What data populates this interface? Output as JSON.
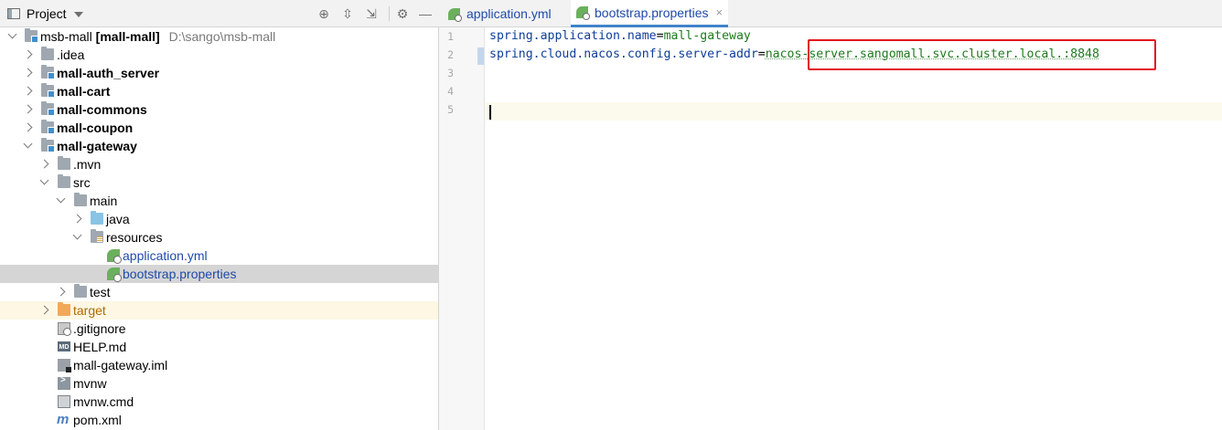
{
  "project_panel": {
    "title": "Project",
    "tree": [
      {
        "label": "msb-mall",
        "bold_suffix": "[mall-mall]",
        "hint": "D:\\sango\\msb-mall",
        "icon": "module-folder-icon"
      },
      {
        "label": ".idea",
        "icon": "folder-icon"
      },
      {
        "label": "mall-auth_server",
        "icon": "module-folder-icon"
      },
      {
        "label": "mall-cart",
        "icon": "module-folder-icon"
      },
      {
        "label": "mall-commons",
        "icon": "module-folder-icon"
      },
      {
        "label": "mall-coupon",
        "icon": "module-folder-icon"
      },
      {
        "label": "mall-gateway",
        "icon": "module-folder-icon"
      },
      {
        "label": ".mvn",
        "icon": "folder-icon"
      },
      {
        "label": "src",
        "icon": "folder-icon"
      },
      {
        "label": "main",
        "icon": "folder-icon"
      },
      {
        "label": "java",
        "icon": "source-folder-icon"
      },
      {
        "label": "resources",
        "icon": "resources-folder-icon"
      },
      {
        "label": "application.yml",
        "icon": "spring-config-icon"
      },
      {
        "label": "bootstrap.properties",
        "icon": "spring-config-icon"
      },
      {
        "label": "test",
        "icon": "folder-icon"
      },
      {
        "label": "target",
        "icon": "excluded-folder-icon"
      },
      {
        "label": ".gitignore",
        "icon": "gitignore-icon"
      },
      {
        "label": "HELP.md",
        "icon": "markdown-icon"
      },
      {
        "label": "mall-gateway.iml",
        "icon": "iml-icon"
      },
      {
        "label": "mvnw",
        "icon": "terminal-script-icon"
      },
      {
        "label": "mvnw.cmd",
        "icon": "cmd-file-icon"
      },
      {
        "label": "pom.xml",
        "icon": "maven-icon"
      }
    ],
    "md_badge": "MD"
  },
  "editor": {
    "tabs": [
      {
        "label": "application.yml",
        "active": false
      },
      {
        "label": "bootstrap.properties",
        "active": true
      }
    ],
    "close_glyph": "×",
    "lines": [
      {
        "no": "1",
        "key": "spring.application.name",
        "eq": "=",
        "value": "mall-gateway"
      },
      {
        "no": "2",
        "key": "spring.cloud.nacos.config.server-addr",
        "eq": "=",
        "value": "nacos-server.sangomall.svc.cluster.local.:8848"
      },
      {
        "no": "3",
        "key": "",
        "eq": "",
        "value": ""
      },
      {
        "no": "4",
        "key": "",
        "eq": "",
        "value": ""
      },
      {
        "no": "5",
        "key": "",
        "eq": "",
        "value": ""
      }
    ]
  },
  "colors": {
    "highlight_box": "#e0141e",
    "tab_underline": "#4083c9",
    "selected_row": "#d5d5d5"
  }
}
